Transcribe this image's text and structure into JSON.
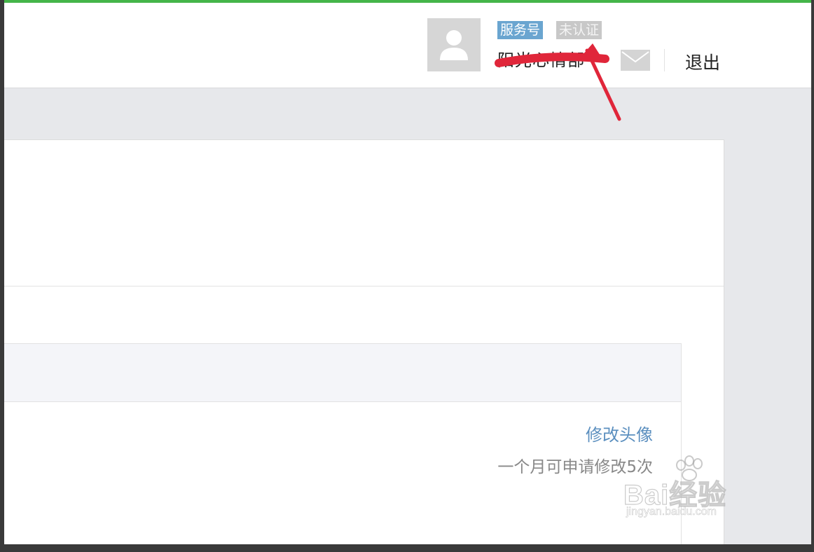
{
  "header": {
    "account_type_badge": "服务号",
    "verification_badge": "未认证",
    "account_name": "阳光心情部",
    "logout_label": "退出",
    "mail_icon": "mail-icon",
    "avatar_icon": "user-avatar-icon"
  },
  "avatar_section": {
    "edit_avatar_label": "修改头像",
    "edit_limit_note": "一个月可申请修改5次"
  },
  "watermark": {
    "brand": "Bai经验",
    "url": "jingyan.baidu.com"
  },
  "colors": {
    "accent_green": "#44b549",
    "badge_blue": "#6aa5d0",
    "link_blue": "#5b8fbf",
    "annotation_red": "#e0263a"
  }
}
